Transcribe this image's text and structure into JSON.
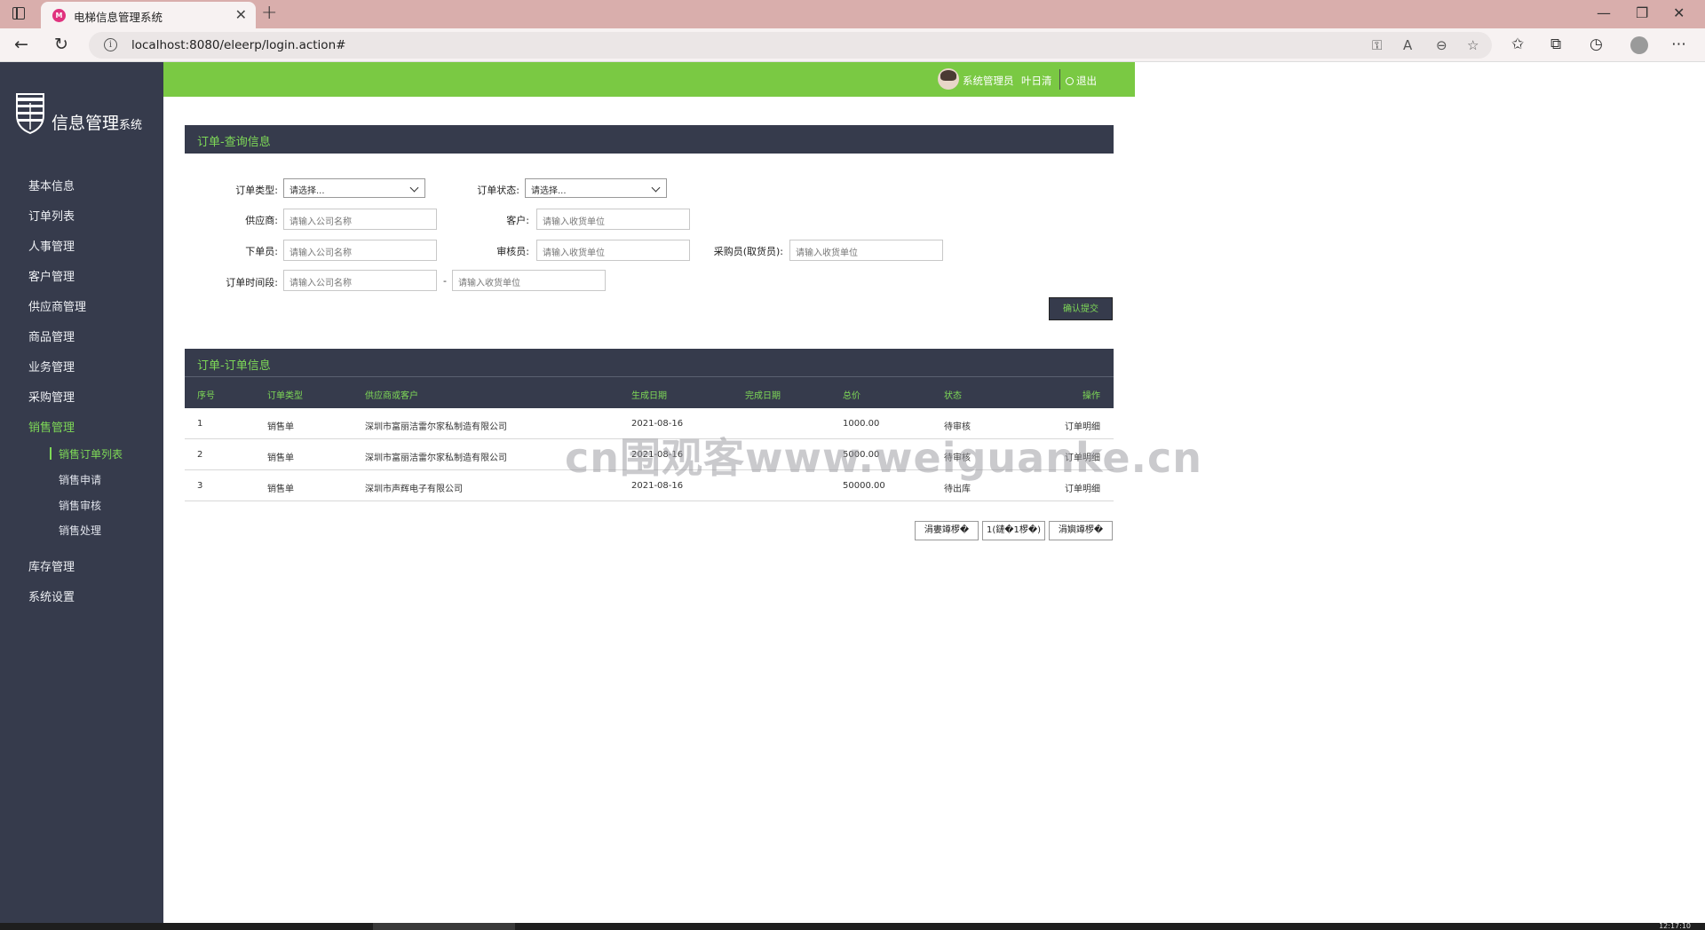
{
  "browser": {
    "tab_title": "电梯信息管理系统",
    "tab_favicon_text": "M",
    "url": "localhost:8080/eleerp/login.action#"
  },
  "sidebar": {
    "logo_text": "信息管理",
    "logo_suffix": "系统",
    "items": [
      {
        "label": "基本信息",
        "active": false
      },
      {
        "label": "订单列表",
        "active": false
      },
      {
        "label": "人事管理",
        "active": false
      },
      {
        "label": "客户管理",
        "active": false
      },
      {
        "label": "供应商管理",
        "active": false
      },
      {
        "label": "商品管理",
        "active": false
      },
      {
        "label": "业务管理",
        "active": false
      },
      {
        "label": "采购管理",
        "active": false
      },
      {
        "label": "销售管理",
        "active": true
      },
      {
        "label": "库存管理",
        "active": false
      },
      {
        "label": "系统设置",
        "active": false
      }
    ],
    "sub_items": [
      {
        "label": "销售订单列表",
        "active": true
      },
      {
        "label": "销售申请",
        "active": false
      },
      {
        "label": "销售审核",
        "active": false
      },
      {
        "label": "销售处理",
        "active": false
      }
    ]
  },
  "topbar": {
    "user_role": "系统管理员",
    "user_name": "叶日清",
    "logout_label": "退出"
  },
  "query_panel": {
    "title": "订单-查询信息",
    "order_type_label": "订单类型:",
    "order_type_value": "请选择...",
    "order_status_label": "订单状态:",
    "order_status_value": "请选择...",
    "supplier_label": "供应商:",
    "supplier_placeholder": "请输入公司名称",
    "customer_label": "客户:",
    "customer_placeholder": "请输入收货单位",
    "orderer_label": "下单员:",
    "orderer_placeholder": "请输入公司名称",
    "reviewer_label": "审核员:",
    "reviewer_placeholder": "请输入收货单位",
    "buyer_label": "采购员(取货员):",
    "buyer_placeholder": "请输入收货单位",
    "period_label": "订单时间段:",
    "period_start_placeholder": "请输入公司名称",
    "period_separator": "-",
    "period_end_placeholder": "请输入收货单位",
    "submit_label": "确认提交"
  },
  "orders_panel": {
    "title": "订单-订单信息",
    "columns": [
      "序号",
      "订单类型",
      "供应商或客户",
      "生成日期",
      "完成日期",
      "总价",
      "状态",
      "操作"
    ],
    "rows": [
      {
        "no": "1",
        "type": "销售单",
        "party": "深圳市富丽洁雷尔家私制造有限公司",
        "created": "2021-08-16",
        "finished": "",
        "total": "1000.00",
        "status": "待审核",
        "action": "订单明细"
      },
      {
        "no": "2",
        "type": "销售单",
        "party": "深圳市富丽洁雷尔家私制造有限公司",
        "created": "2021-08-16",
        "finished": "",
        "total": "5000.00",
        "status": "待审核",
        "action": "订单明细"
      },
      {
        "no": "3",
        "type": "销售单",
        "party": "深圳市声辉电子有限公司",
        "created": "2021-08-16",
        "finished": "",
        "total": "50000.00",
        "status": "待出库",
        "action": "订单明细"
      }
    ],
    "pagination": {
      "prev_label": "涓婁竴椤�",
      "current_label": "1(鏈�1椤�)",
      "next_label": "涓嬩竴椤�"
    }
  },
  "watermark": "cn围观客www.weiguanke.cn",
  "taskbar": {
    "time": "12:17:10"
  }
}
